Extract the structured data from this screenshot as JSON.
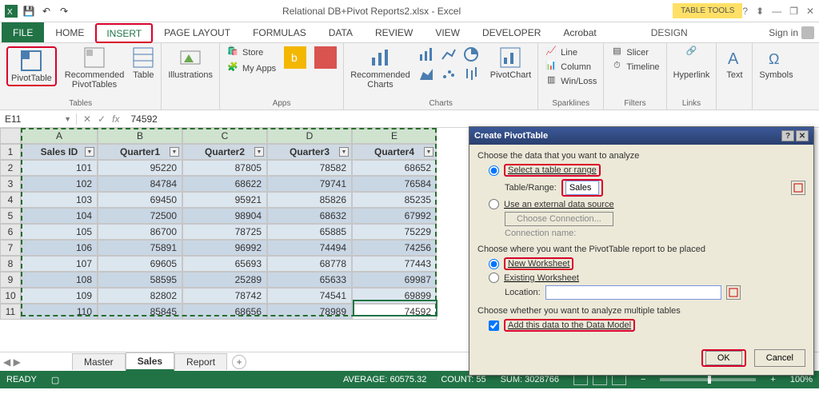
{
  "title": {
    "filename": "Relational DB+Pivot Reports2.xlsx - Excel",
    "context_tools": "TABLE TOOLS"
  },
  "qat": {
    "save": "💾",
    "undo": "↶",
    "redo": "↷"
  },
  "title_right": {
    "help": "?",
    "ribbon_toggle": "⬍",
    "min": "—",
    "restore": "❐",
    "close": "✕"
  },
  "tabs": {
    "file": "FILE",
    "home": "HOME",
    "insert": "INSERT",
    "pagelayout": "PAGE LAYOUT",
    "formulas": "FORMULAS",
    "data": "DATA",
    "review": "REVIEW",
    "view": "VIEW",
    "developer": "DEVELOPER",
    "acrobat": "Acrobat",
    "design": "DESIGN"
  },
  "signin": "Sign in",
  "ribbon": {
    "pivottable": "PivotTable",
    "recpivot": "Recommended\nPivotTables",
    "table": "Table",
    "illustrations": "Illustrations",
    "store": "Store",
    "myapps": "My Apps",
    "bing": "",
    "reccharts": "Recommended\nCharts",
    "pivotchart": "PivotChart",
    "line": "Line",
    "column": "Column",
    "winloss": "Win/Loss",
    "slicer": "Slicer",
    "timeline": "Timeline",
    "hyperlink": "Hyperlink",
    "text": "Text",
    "symbols": "Symbols",
    "g_tables": "Tables",
    "g_apps": "Apps",
    "g_charts": "Charts",
    "g_sparklines": "Sparklines",
    "g_filters": "Filters",
    "g_links": "Links"
  },
  "fbar": {
    "name": "E11",
    "formula": "74592",
    "fx": "fx"
  },
  "cols": [
    "A",
    "B",
    "C",
    "D",
    "E"
  ],
  "headers": [
    "Sales ID",
    "Quarter1",
    "Quarter2",
    "Quarter3",
    "Quarter4"
  ],
  "rows": [
    {
      "n": "1"
    },
    {
      "n": "2",
      "d": [
        "101",
        "95220",
        "87805",
        "78582",
        "68652"
      ]
    },
    {
      "n": "3",
      "d": [
        "102",
        "84784",
        "68622",
        "79741",
        "76584"
      ]
    },
    {
      "n": "4",
      "d": [
        "103",
        "69450",
        "95921",
        "85826",
        "85235"
      ]
    },
    {
      "n": "5",
      "d": [
        "104",
        "72500",
        "98904",
        "68632",
        "67992"
      ]
    },
    {
      "n": "6",
      "d": [
        "105",
        "86700",
        "78725",
        "65885",
        "75229"
      ]
    },
    {
      "n": "7",
      "d": [
        "106",
        "75891",
        "96992",
        "74494",
        "74256"
      ]
    },
    {
      "n": "8",
      "d": [
        "107",
        "69605",
        "65693",
        "68778",
        "77443"
      ]
    },
    {
      "n": "9",
      "d": [
        "108",
        "58595",
        "25289",
        "65633",
        "69987"
      ]
    },
    {
      "n": "10",
      "d": [
        "109",
        "82802",
        "78742",
        "74541",
        "69899"
      ]
    },
    {
      "n": "11",
      "d": [
        "110",
        "85845",
        "68656",
        "78989",
        "74592"
      ]
    }
  ],
  "sheets": {
    "master": "Master",
    "sales": "Sales",
    "report": "Report"
  },
  "status": {
    "ready": "READY",
    "avg": "AVERAGE: 60575.32",
    "count": "COUNT: 55",
    "sum": "SUM: 3028766",
    "zoom": "100%"
  },
  "dialog": {
    "title": "Create PivotTable",
    "s1": "Choose the data that you want to analyze",
    "opt_range": "Select a table or range",
    "tbl_label": "Table/Range:",
    "tbl_value": "Sales",
    "opt_ext": "Use an external data source",
    "choose_conn": "Choose Connection...",
    "conn_name": "Connection name:",
    "s2": "Choose where you want the PivotTable report to be placed",
    "opt_new": "New Worksheet",
    "opt_exist": "Existing Worksheet",
    "loc_label": "Location:",
    "loc_value": "",
    "s3": "Choose whether you want to analyze multiple tables",
    "chk_model": "Add this data to the Data Model",
    "ok": "OK",
    "cancel": "Cancel"
  }
}
